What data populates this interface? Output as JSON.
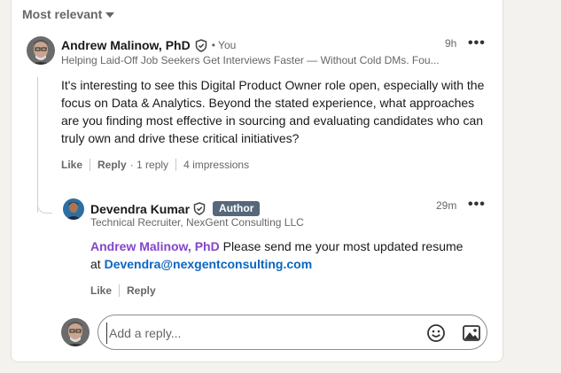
{
  "sort": {
    "label": "Most relevant"
  },
  "comment": {
    "author": "Andrew Malinow, PhD",
    "relation": "• You",
    "headline": "Helping Laid-Off Job Seekers Get Interviews Faster — Without Cold DMs. Fou...",
    "time": "9h",
    "body": "It's interesting to see this Digital Product Owner role open, especially with the focus on Data & Analytics. Beyond the stated experience, what approaches are you finding most effective in sourcing and evaluating candidates who can truly own and drive these critical initiatives?",
    "like_label": "Like",
    "reply_label": "Reply",
    "reply_count": "· 1 reply",
    "impressions": "4 impressions"
  },
  "reply": {
    "author": "Devendra Kumar",
    "badge": "Author",
    "headline": "Technical Recruiter, NexGent Consulting LLC",
    "time": "29m",
    "mention": "Andrew Malinow, PhD",
    "text_part1": "Please send me your most updated resume",
    "text_at": "at",
    "email": "Devendra@nexgentconsulting.com",
    "like_label": "Like",
    "reply_label": "Reply"
  },
  "composer": {
    "placeholder": "Add a reply..."
  },
  "colors": {
    "mention": "#8344cc",
    "link": "#0a66c2",
    "badge_bg": "#56687a"
  }
}
